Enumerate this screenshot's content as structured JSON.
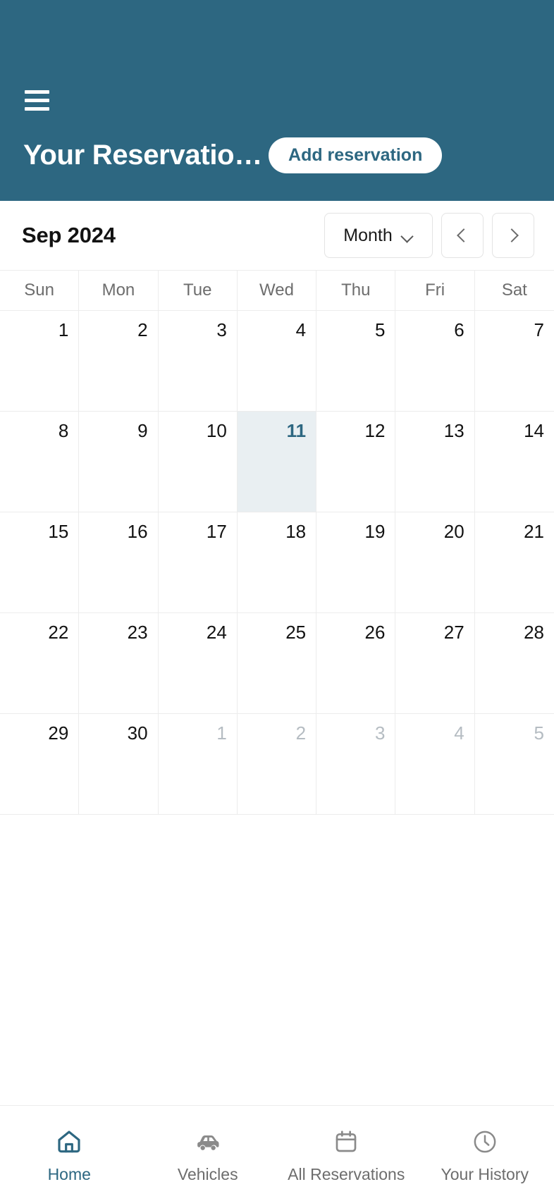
{
  "theme": {
    "brand": "#2d6781",
    "muted_text": "#6d6d6d",
    "today_bg": "#e9eff2",
    "border": "#ececec",
    "next_month_text": "#b5bcc2"
  },
  "header": {
    "menu_icon": "hamburger-menu-icon",
    "title": "Your Reservatio…",
    "add_button_label": "Add reservation"
  },
  "toolbar": {
    "period_label": "Sep 2024",
    "view_selected": "Month",
    "view_options": [
      "Month"
    ],
    "chevron_icon": "chevron-down-icon",
    "prev_label": "‹",
    "next_label": "›"
  },
  "calendar": {
    "weekdays": [
      "Sun",
      "Mon",
      "Tue",
      "Wed",
      "Thu",
      "Fri",
      "Sat"
    ],
    "today": 11,
    "weeks": [
      [
        {
          "d": "1",
          "muted": false,
          "today": false
        },
        {
          "d": "2",
          "muted": false,
          "today": false
        },
        {
          "d": "3",
          "muted": false,
          "today": false
        },
        {
          "d": "4",
          "muted": false,
          "today": false
        },
        {
          "d": "5",
          "muted": false,
          "today": false
        },
        {
          "d": "6",
          "muted": false,
          "today": false
        },
        {
          "d": "7",
          "muted": false,
          "today": false
        }
      ],
      [
        {
          "d": "8",
          "muted": false,
          "today": false
        },
        {
          "d": "9",
          "muted": false,
          "today": false
        },
        {
          "d": "10",
          "muted": false,
          "today": false
        },
        {
          "d": "11",
          "muted": false,
          "today": true
        },
        {
          "d": "12",
          "muted": false,
          "today": false
        },
        {
          "d": "13",
          "muted": false,
          "today": false
        },
        {
          "d": "14",
          "muted": false,
          "today": false
        }
      ],
      [
        {
          "d": "15",
          "muted": false,
          "today": false
        },
        {
          "d": "16",
          "muted": false,
          "today": false
        },
        {
          "d": "17",
          "muted": false,
          "today": false
        },
        {
          "d": "18",
          "muted": false,
          "today": false
        },
        {
          "d": "19",
          "muted": false,
          "today": false
        },
        {
          "d": "20",
          "muted": false,
          "today": false
        },
        {
          "d": "21",
          "muted": false,
          "today": false
        }
      ],
      [
        {
          "d": "22",
          "muted": false,
          "today": false
        },
        {
          "d": "23",
          "muted": false,
          "today": false
        },
        {
          "d": "24",
          "muted": false,
          "today": false
        },
        {
          "d": "25",
          "muted": false,
          "today": false
        },
        {
          "d": "26",
          "muted": false,
          "today": false
        },
        {
          "d": "27",
          "muted": false,
          "today": false
        },
        {
          "d": "28",
          "muted": false,
          "today": false
        }
      ],
      [
        {
          "d": "29",
          "muted": false,
          "today": false
        },
        {
          "d": "30",
          "muted": false,
          "today": false
        },
        {
          "d": "1",
          "muted": true,
          "today": false
        },
        {
          "d": "2",
          "muted": true,
          "today": false
        },
        {
          "d": "3",
          "muted": true,
          "today": false
        },
        {
          "d": "4",
          "muted": true,
          "today": false
        },
        {
          "d": "5",
          "muted": true,
          "today": false
        }
      ]
    ],
    "events": []
  },
  "bottom_nav": {
    "items": [
      {
        "label": "Home",
        "icon": "home-icon",
        "active": true
      },
      {
        "label": "Vehicles",
        "icon": "car-icon",
        "active": false
      },
      {
        "label": "All Reservations",
        "icon": "calendar-icon",
        "active": false
      },
      {
        "label": "Your History",
        "icon": "clock-icon",
        "active": false
      }
    ]
  }
}
